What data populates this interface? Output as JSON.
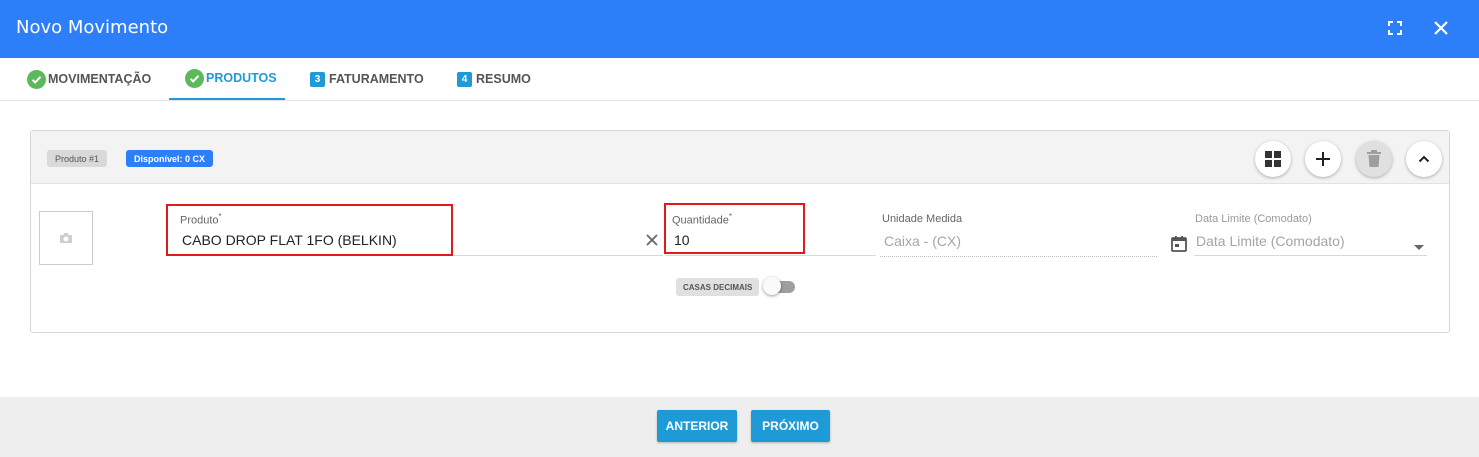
{
  "dialog": {
    "title": "Novo Movimento",
    "accent_color": "#2d7ff9",
    "icons": {
      "fullscreen": "fullscreen-icon",
      "close": "close-icon"
    }
  },
  "tabs": [
    {
      "label": "MOVIMENTAÇÃO",
      "state": "done",
      "marker": ""
    },
    {
      "label": "PRODUTOS",
      "state": "active-done",
      "marker": ""
    },
    {
      "label": "FATURAMENTO",
      "state": "pending",
      "marker": "3"
    },
    {
      "label": "RESUMO",
      "state": "pending",
      "marker": "4"
    }
  ],
  "product_card": {
    "badge_product": "Produto #1",
    "badge_available": "Disponível: 0 CX",
    "actions": [
      "grid-icon",
      "plus-icon",
      "trash-icon",
      "chevron-up-icon"
    ],
    "fields": {
      "produto": {
        "label": "Produto",
        "required_mark": "*",
        "value": "CABO DROP FLAT 1FO (BELKIN)"
      },
      "quantidade": {
        "label": "Quantidade",
        "required_mark": "*",
        "value": "10"
      },
      "unidade": {
        "label": "Unidade Medida",
        "value": "Caixa - (CX)"
      },
      "data_limite": {
        "label": "Data Limite (Comodato)",
        "placeholder": "Data Limite (Comodato)"
      }
    },
    "toggle": {
      "label": "CASAS DECIMAIS",
      "on": false
    }
  },
  "footer": {
    "previous_label": "ANTERIOR",
    "next_label": "PRÓXIMO"
  }
}
